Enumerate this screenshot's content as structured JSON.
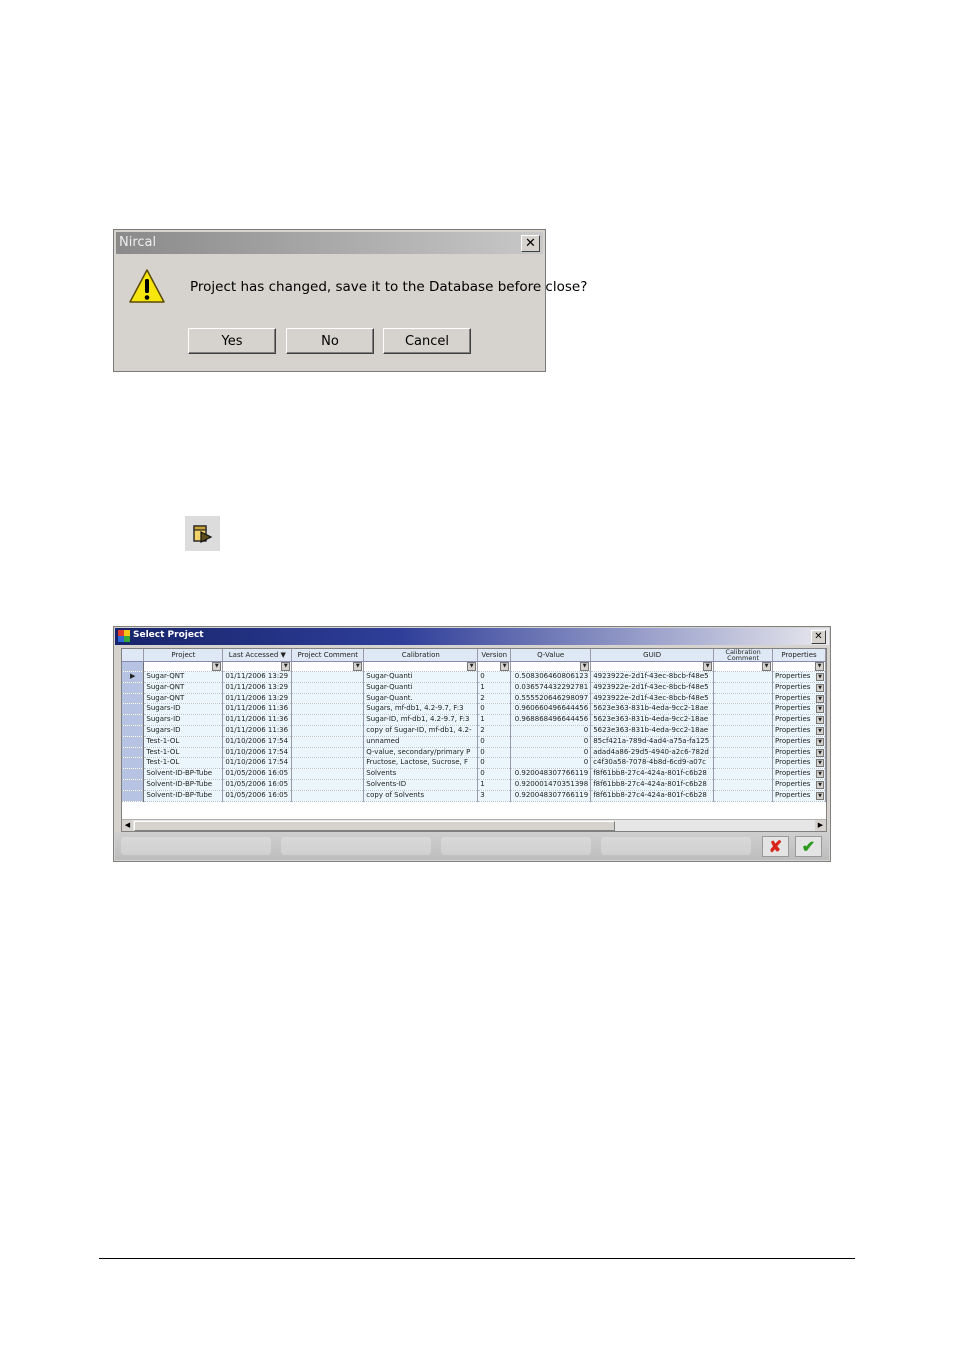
{
  "dialog": {
    "title": "Nircal",
    "close_glyph": "✕",
    "message": "Project has changed, save it to the Database before close?",
    "icon": "warning-icon",
    "buttons": {
      "yes": "Yes",
      "no": "No",
      "cancel": "Cancel"
    }
  },
  "toolbar_icon": "open-project-icon",
  "select_project": {
    "title": "Select Project",
    "close_glyph": "✕",
    "columns": [
      "",
      "Project",
      "Last Accessed",
      "Project Comment",
      "Calibration",
      "Version",
      "Q-Value",
      "GUID",
      "Calibration Comment",
      "Properties"
    ],
    "sort_indicator": "▼",
    "current_row_marker": "▶",
    "rows": [
      [
        "Sugar-QNT",
        "01/11/2006 13:29",
        "",
        "Sugar-Quanti",
        "0",
        "0.508306460806123",
        "4923922e-2d1f-43ec-8bcb-f48e5",
        "",
        "Properties"
      ],
      [
        "Sugar-QNT",
        "01/11/2006 13:29",
        "",
        "Sugar-Quanti",
        "1",
        "0.036574432292781",
        "4923922e-2d1f-43ec-8bcb-f48e5",
        "",
        "Properties"
      ],
      [
        "Sugar-QNT",
        "01/11/2006 13:29",
        "",
        "Sugar-Quant.",
        "2",
        "0.555520646298097",
        "4923922e-2d1f-43ec-8bcb-f48e5",
        "",
        "Properties"
      ],
      [
        "Sugars-ID",
        "01/11/2006 11:36",
        "",
        "Sugars, mf-db1, 4.2-9.7, F:3",
        "0",
        "0.960660496644456",
        "5623e363-831b-4eda-9cc2-18ae",
        "",
        "Properties"
      ],
      [
        "Sugars-ID",
        "01/11/2006 11:36",
        "",
        "Sugar-ID, mf-db1, 4.2-9.7, F:3",
        "1",
        "0.968868496644456",
        "5623e363-831b-4eda-9cc2-18ae",
        "",
        "Properties"
      ],
      [
        "Sugars-ID",
        "01/11/2006 11:36",
        "",
        "copy of Sugar-ID, mf-db1, 4.2-",
        "2",
        "0",
        "5623e363-831b-4eda-9cc2-18ae",
        "",
        "Properties"
      ],
      [
        "Test-1-OL",
        "01/10/2006 17:54",
        "",
        "unnamed",
        "0",
        "0",
        "85cf421a-789d-4ad4-a75a-fa125",
        "",
        "Properties"
      ],
      [
        "Test-1-OL",
        "01/10/2006 17:54",
        "",
        "Q-value, secondary/primary P",
        "0",
        "0",
        "adad4a86-29d5-4940-a2c6-782d",
        "",
        "Properties"
      ],
      [
        "Test-1-OL",
        "01/10/2006 17:54",
        "",
        "Fructose, Lactose, Sucrose, F",
        "0",
        "0",
        "c4f30a58-7078-4b8d-6cd9-a07c",
        "",
        "Properties"
      ],
      [
        "Solvent-ID-BP-Tube",
        "01/05/2006 16:05",
        "",
        "Solvents",
        "0",
        "0.920048307766119",
        "f8f61bb8-27c4-424a-801f-c6b28",
        "",
        "Properties"
      ],
      [
        "Solvent-ID-BP-Tube",
        "01/05/2006 16:05",
        "",
        "Solvents-ID",
        "1",
        "0.920001470351398",
        "f8f61bb8-27c4-424a-801f-c6b28",
        "",
        "Properties"
      ],
      [
        "Solvent-ID-BP-Tube",
        "01/05/2006 16:05",
        "",
        "copy of Solvents",
        "3",
        "0.920048307766119",
        "f8f61bb8-27c4-424a-801f-c6b28",
        "",
        "Properties"
      ]
    ],
    "cancel_glyph": "✘",
    "ok_glyph": "✔",
    "colors": {
      "title_bar": "#17246b",
      "row_bg": "#eaf6fb",
      "header_bg": "#dfe9f6",
      "cancel": "#d8261a",
      "ok": "#2a9a1c"
    }
  }
}
